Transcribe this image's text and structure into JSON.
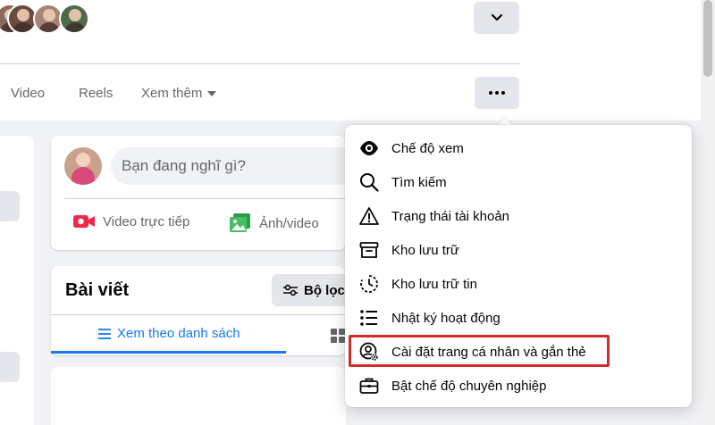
{
  "top": {
    "friend_avatars": [
      "friend-1",
      "friend-2",
      "friend-3",
      "friend-4"
    ]
  },
  "tabs": [
    {
      "label": "Video"
    },
    {
      "label": "Reels"
    },
    {
      "label": "Xem thêm"
    }
  ],
  "composer": {
    "placeholder": "Bạn đang nghĩ gì?",
    "actions": [
      {
        "label": "Video trực tiếp",
        "icon": "live-video-icon",
        "color": "#f02849"
      },
      {
        "label": "Ảnh/video",
        "icon": "photo-video-icon",
        "color": "#45bd62"
      }
    ]
  },
  "posts": {
    "title": "Bài viết",
    "filter_label": "Bộ lọc",
    "list_view_label": "Xem theo danh sách",
    "accent": "#1877f2"
  },
  "menu": {
    "items": [
      {
        "label": "Chế độ xem",
        "icon": "eye-icon"
      },
      {
        "label": "Tìm kiếm",
        "icon": "search-icon"
      },
      {
        "label": "Trạng thái tài khoản",
        "icon": "warning-icon"
      },
      {
        "label": "Kho lưu trữ",
        "icon": "archive-icon"
      },
      {
        "label": "Kho lưu trữ tin",
        "icon": "story-archive-icon"
      },
      {
        "label": "Nhật ký hoạt động",
        "icon": "activity-log-icon"
      },
      {
        "label": "Cài đặt trang cá nhân và gắn thẻ",
        "icon": "profile-settings-icon",
        "highlighted": true
      },
      {
        "label": "Bật chế độ chuyên nghiệp",
        "icon": "briefcase-icon"
      }
    ],
    "highlight_color": "#d12c2c"
  }
}
